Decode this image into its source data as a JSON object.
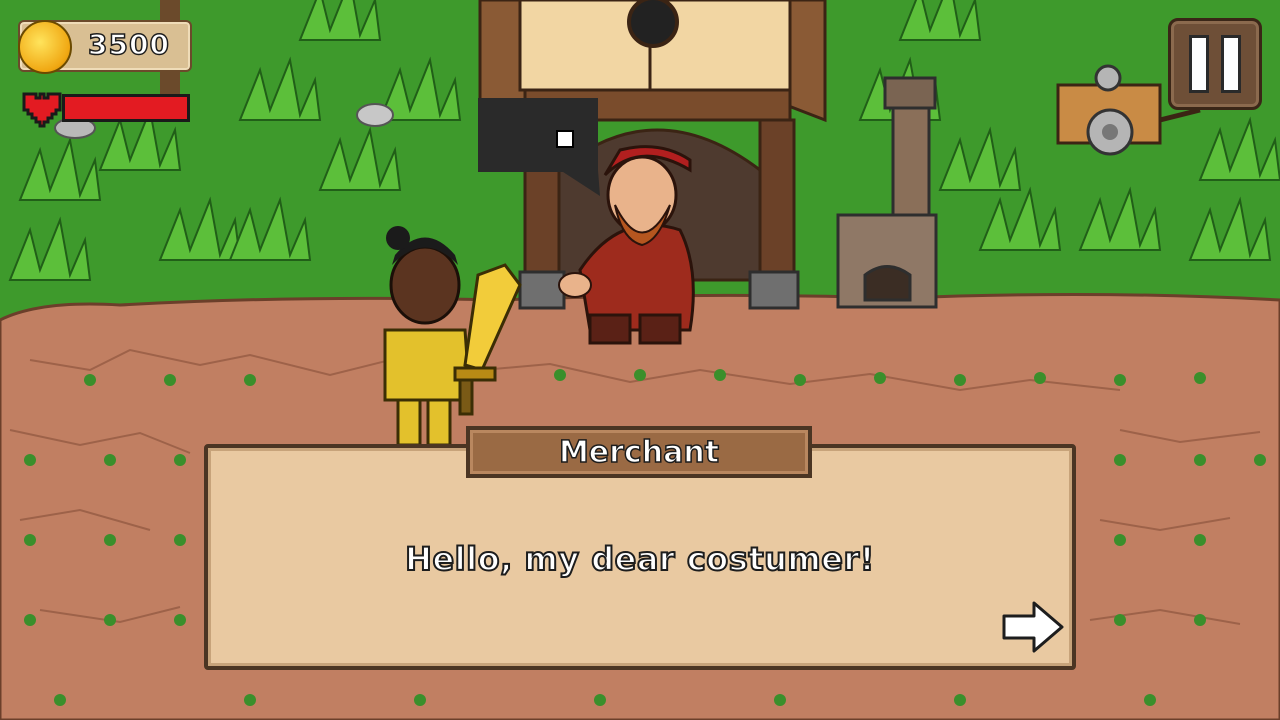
{
  "hud": {
    "coins": "3500",
    "health_percent": 100,
    "icons": {
      "coin": "gold-coin-icon",
      "heart": "heart-icon",
      "pause": "pause-icon"
    },
    "colors": {
      "health": "#e31b22",
      "coin": "#f0a712"
    }
  },
  "npc_speech": {
    "icon": "speech-bubble-icon"
  },
  "dialogue": {
    "speaker": "Merchant",
    "text": "Hello, my dear costumer!",
    "next_icon": "arrow-right-icon"
  }
}
